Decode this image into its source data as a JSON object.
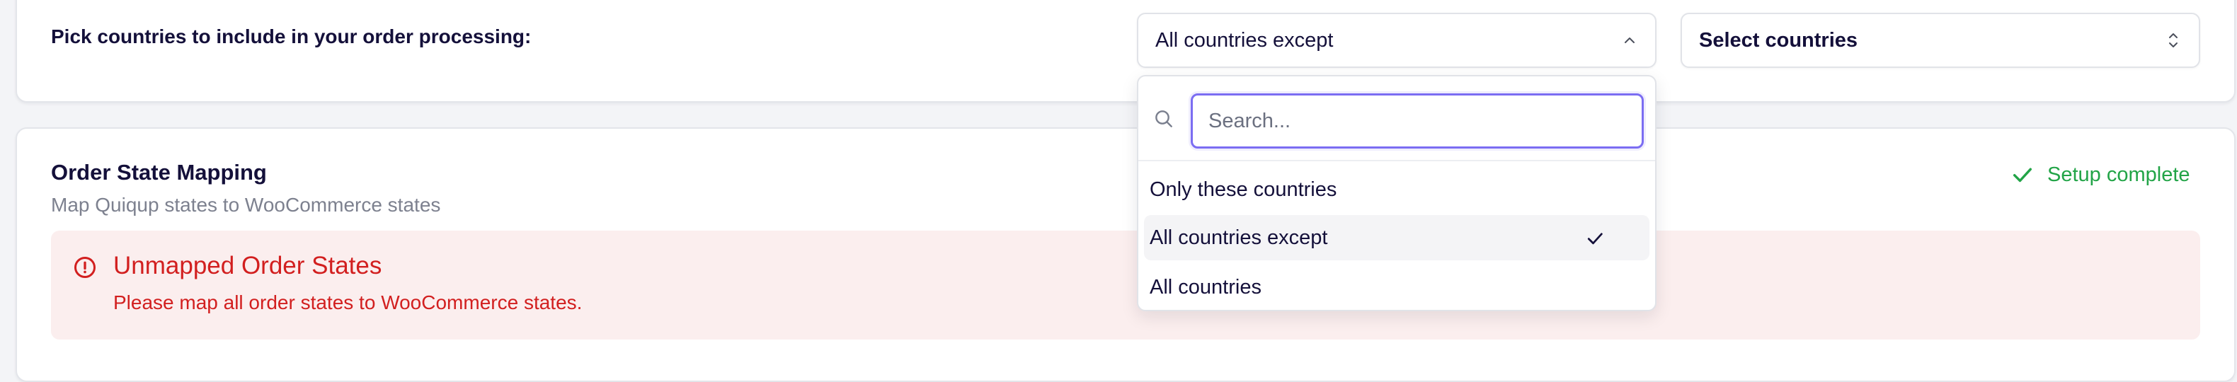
{
  "countries": {
    "label": "Pick countries to include in your order processing:",
    "mode_select": {
      "value": "All countries except",
      "icon": "chevron-up-icon"
    },
    "country_select": {
      "value": "Select countries",
      "icon": "chevron-updown-icon"
    },
    "dropdown": {
      "search_placeholder": "Search...",
      "options": [
        {
          "label": "Only these countries",
          "selected": false
        },
        {
          "label": "All countries except",
          "selected": true
        },
        {
          "label": "All countries",
          "selected": false
        }
      ]
    }
  },
  "order_state_mapping": {
    "title": "Order State Mapping",
    "subtitle": "Map Quiqup states to WooCommerce states",
    "status": {
      "label": "Setup complete",
      "color": "#22a447",
      "icon": "check-icon"
    },
    "alert": {
      "title": "Unmapped Order States",
      "message": "Please map all order states to WooCommerce states.",
      "color": "#d21f1f",
      "background": "#fbeeee",
      "icon": "alert-circle-icon"
    }
  },
  "colors": {
    "text": "#14103a",
    "muted": "#7d818f",
    "focus": "#7b6df2",
    "success": "#22a447",
    "danger": "#d21f1f"
  }
}
